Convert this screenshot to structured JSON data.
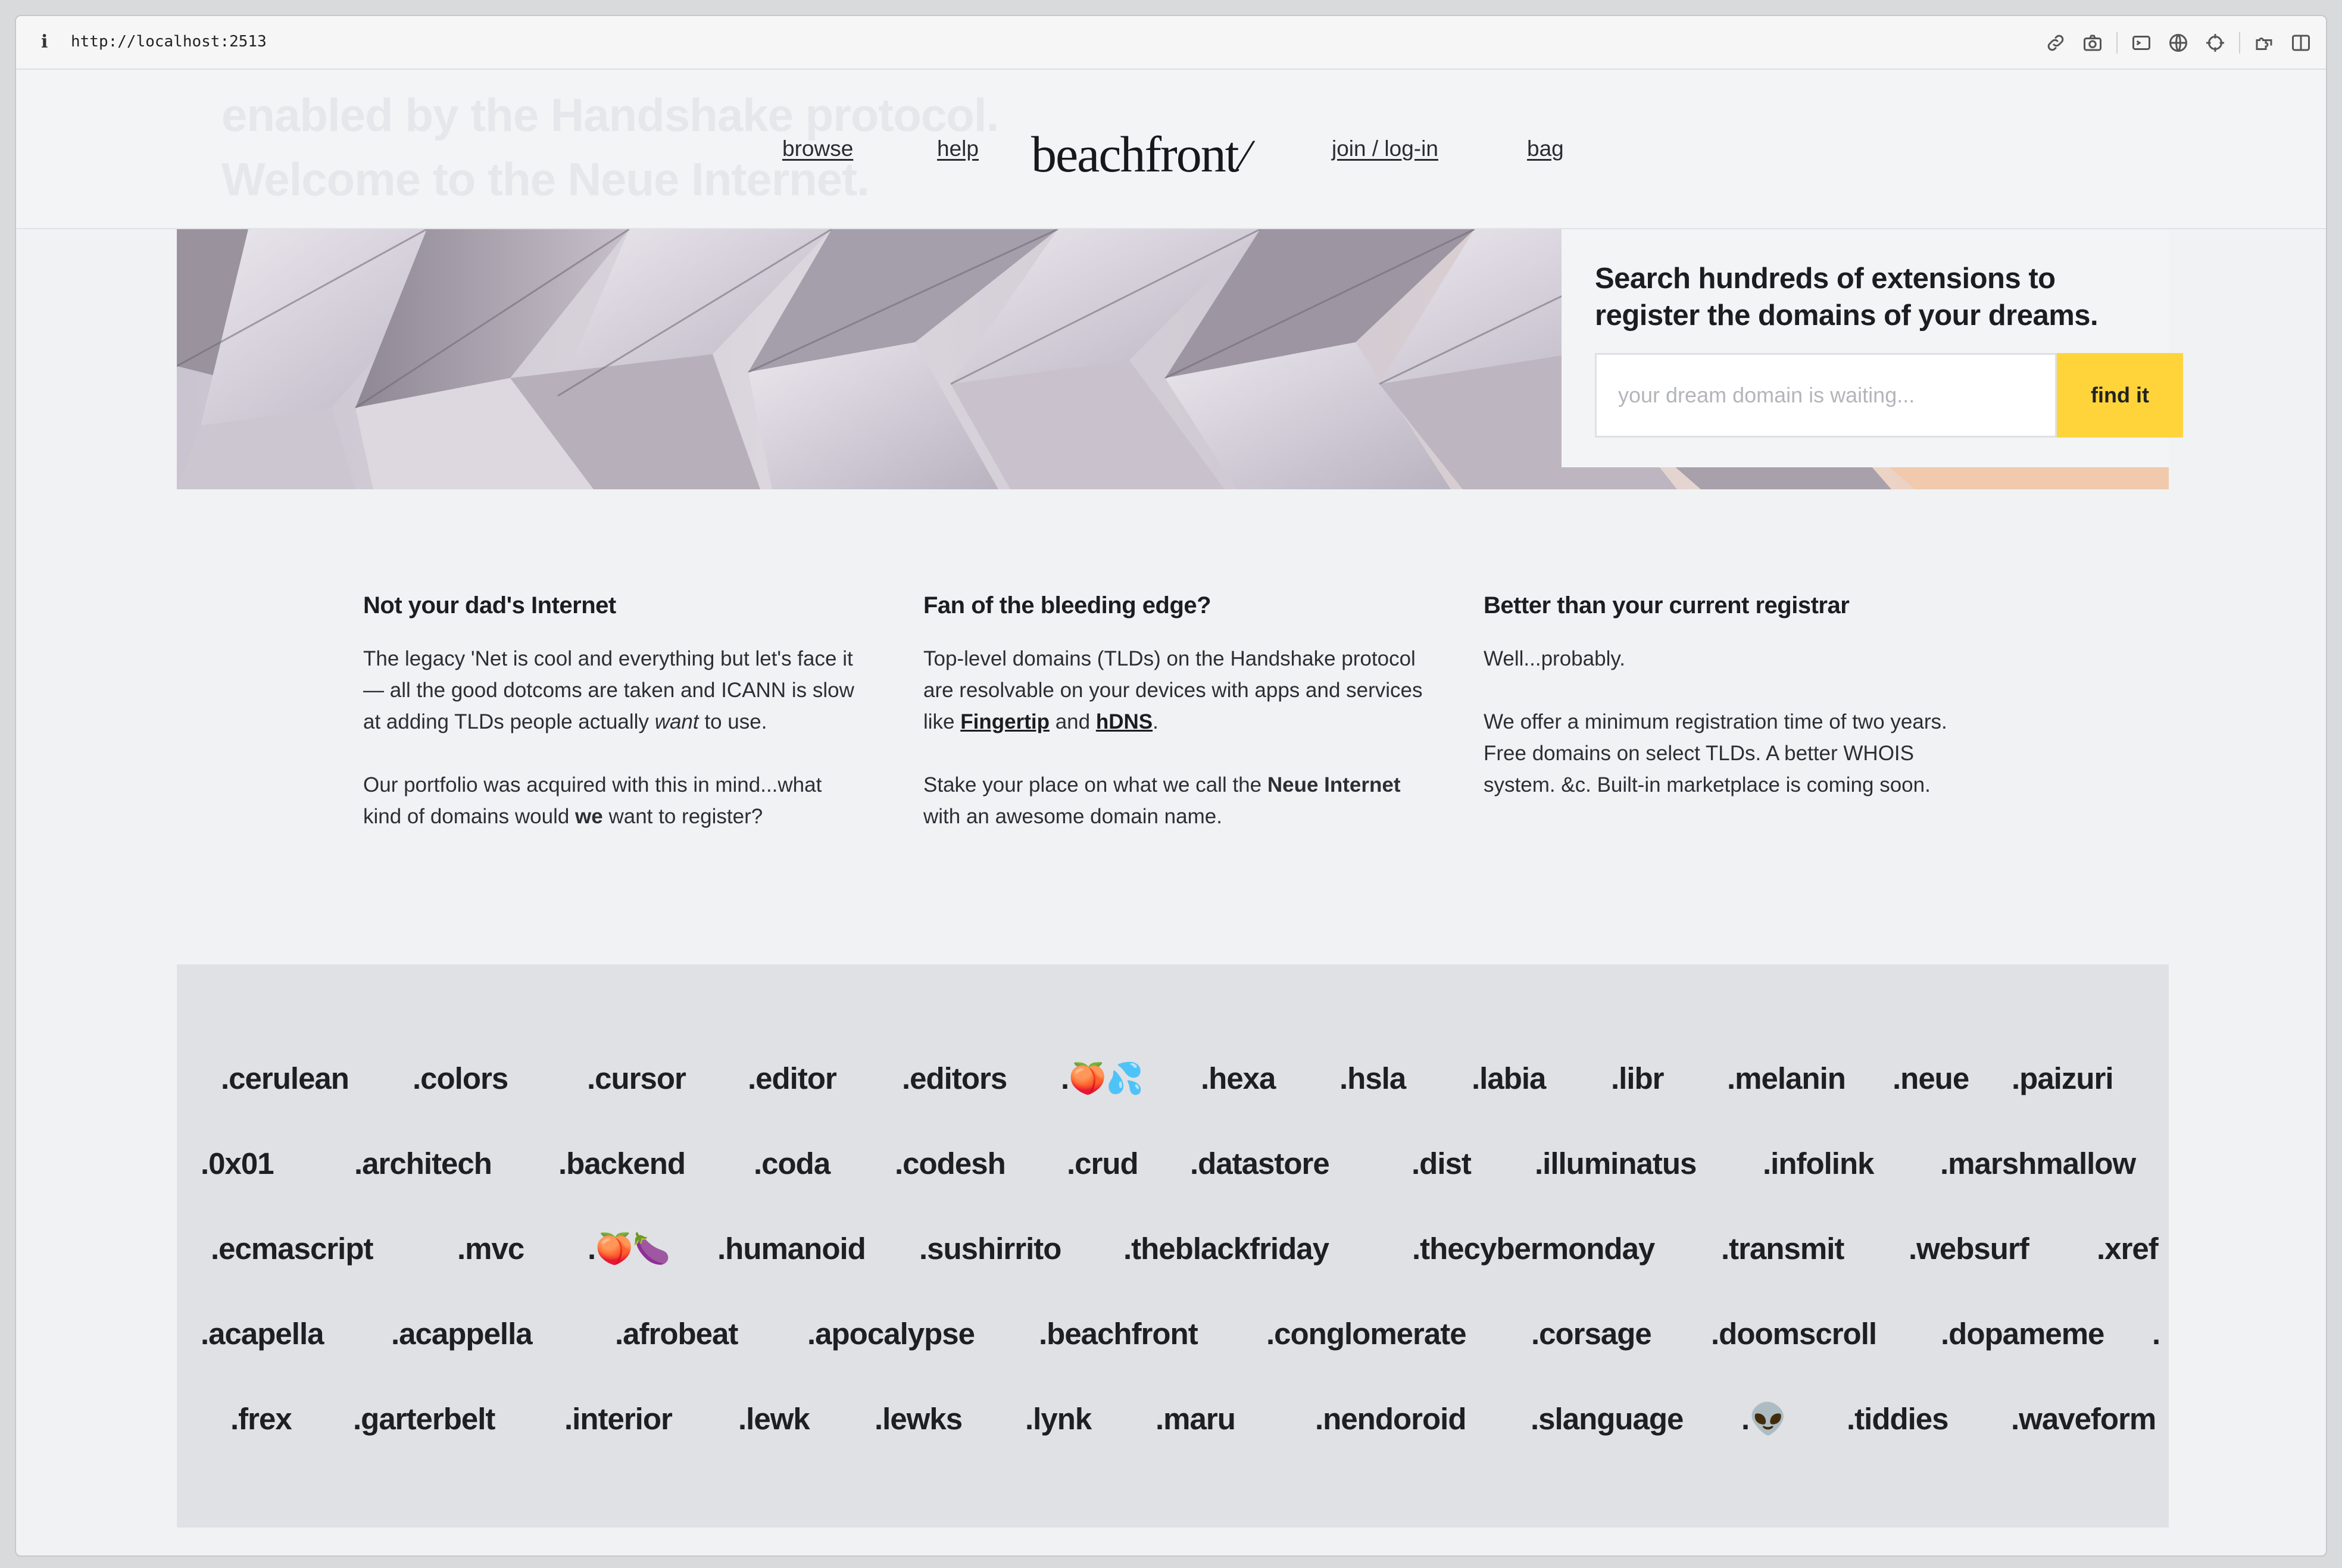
{
  "browser": {
    "info_icon": "i",
    "url": "http://localhost:2513",
    "tools": [
      "link-icon",
      "camera-icon",
      "terminal-icon",
      "globe-icon",
      "crosshair-icon",
      "extension-icon",
      "sidebar-icon"
    ]
  },
  "header": {
    "ghost_line1": "enabled by the Handshake protocol.",
    "ghost_line2": "Welcome to the Neue Internet.",
    "nav_browse": "browse",
    "nav_help": "help",
    "logo": "beachfront",
    "logo_slash": "/",
    "nav_join": "join / log-in",
    "nav_bag": "bag"
  },
  "search": {
    "heading": "Search hundreds of extensions to register the domains of your dreams.",
    "placeholder": "your dream domain is waiting...",
    "button": "find it"
  },
  "features": [
    {
      "title": "Not your dad's Internet",
      "p1_a": "The legacy 'Net is cool and everything but let's face it — all the good dotcoms are taken and ICANN is slow at adding TLDs people actually ",
      "p1_em": "want",
      "p1_b": " to use.",
      "p2_a": "Our portfolio was acquired with this in mind...what kind of domains would ",
      "p2_strong": "we",
      "p2_b": " want to register?"
    },
    {
      "title": "Fan of the bleeding edge?",
      "p1_a": "Top-level domains (TLDs) on the Handshake protocol are resolvable on your devices with apps and services like ",
      "link1": "Fingertip",
      "p1_and": " and ",
      "link2": "hDNS",
      "p1_end": ".",
      "p2_a": "Stake your place on what we call the ",
      "p2_strong": "Neue Internet",
      "p2_b": " with an awesome domain name."
    },
    {
      "title": "Better than your current registrar",
      "p1": "Well...probably.",
      "p2": "We offer a minimum registration time of two years. Free domains on select TLDs. A better WHOIS system. &c. Built-in marketplace is coming soon."
    }
  ],
  "tld_rows": [
    [
      ".cerulean",
      ".colors",
      ".cursor",
      ".editor",
      ".editors",
      ".🍑💦",
      ".hexa",
      ".hsla",
      ".labia",
      ".libr",
      ".melanin",
      ".neue",
      ".paizuri"
    ],
    [
      ".0x01",
      ".architech",
      ".backend",
      ".coda",
      ".codesh",
      ".crud",
      ".datastore",
      ".dist",
      ".illuminatus",
      ".infolink",
      ".marshmallow"
    ],
    [
      ".ecmascript",
      ".mvc",
      ".🍑🍆",
      ".humanoid",
      ".sushirrito",
      ".theblackfriday",
      ".thecybermonday",
      ".transmit",
      ".websurf",
      ".xref"
    ],
    [
      ".acapella",
      ".acappella",
      ".afrobeat",
      ".apocalypse",
      ".beachfront",
      ".conglomerate",
      ".corsage",
      ".doomscroll",
      ".dopameme",
      "."
    ],
    [
      ".frex",
      ".garterbelt",
      ".interior",
      ".lewk",
      ".lewks",
      ".lynk",
      ".maru",
      ".nendoroid",
      ".slanguage",
      ".👽",
      ".tiddies",
      ".waveform"
    ]
  ]
}
